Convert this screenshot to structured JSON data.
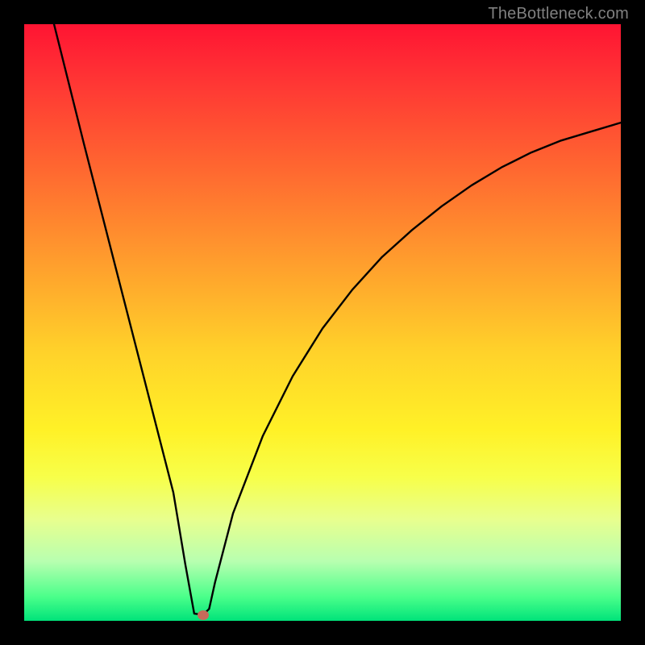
{
  "watermark": "TheBottleneck.com",
  "chart_data": {
    "type": "line",
    "title": "",
    "xlabel": "",
    "ylabel": "",
    "xlim": [
      0,
      100
    ],
    "ylim": [
      0,
      100
    ],
    "grid": false,
    "legend": false,
    "series": [
      {
        "name": "bottleneck-curve",
        "x": [
          5,
          10,
          15,
          20,
          25,
          27,
          28.5,
          30,
          31,
          32,
          35,
          40,
          45,
          50,
          55,
          60,
          65,
          70,
          75,
          80,
          85,
          90,
          95,
          100
        ],
        "values": [
          100,
          80,
          60.5,
          41,
          21.5,
          9.5,
          1.2,
          1.0,
          2.0,
          6.5,
          18,
          31,
          41,
          49,
          55.5,
          61,
          65.5,
          69.5,
          73,
          76,
          78.5,
          80.5,
          82,
          83.5
        ]
      }
    ],
    "marker": {
      "x": 30,
      "y": 1.0,
      "color": "#c76a5a"
    },
    "gradient_stops": [
      {
        "pos": 0,
        "color": "#ff1433"
      },
      {
        "pos": 10,
        "color": "#ff3734"
      },
      {
        "pos": 25,
        "color": "#ff6a30"
      },
      {
        "pos": 40,
        "color": "#ff9e2d"
      },
      {
        "pos": 55,
        "color": "#ffd22a"
      },
      {
        "pos": 68,
        "color": "#fff127"
      },
      {
        "pos": 76,
        "color": "#f7ff4a"
      },
      {
        "pos": 83,
        "color": "#e8ff8e"
      },
      {
        "pos": 90,
        "color": "#b8ffb0"
      },
      {
        "pos": 96,
        "color": "#4aff8a"
      },
      {
        "pos": 100,
        "color": "#00e37a"
      }
    ]
  }
}
